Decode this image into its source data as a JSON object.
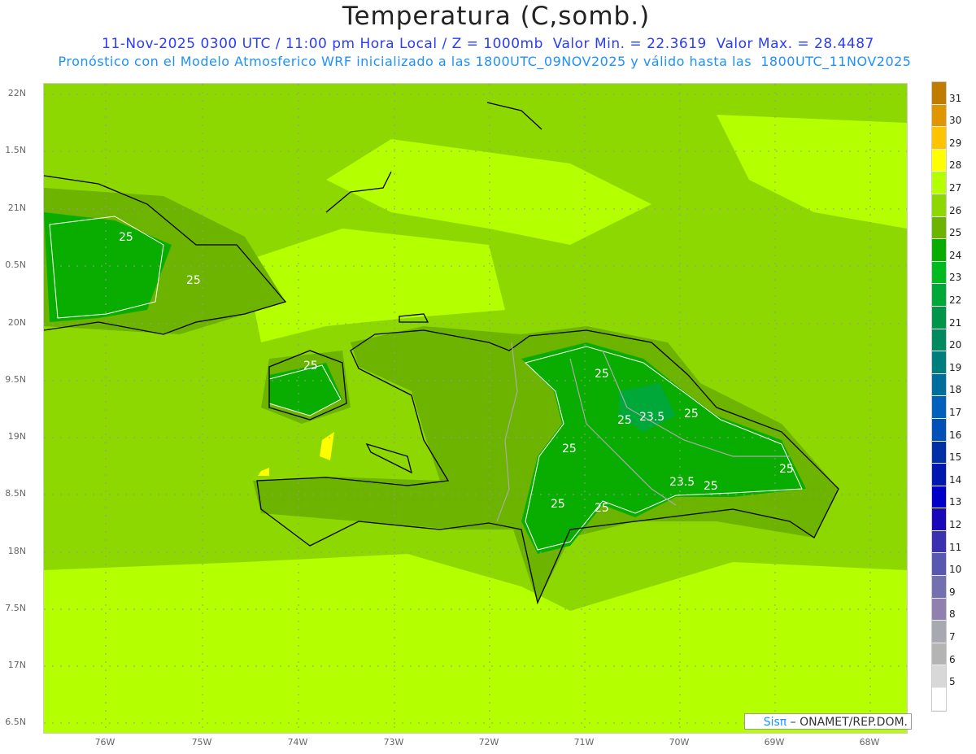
{
  "title": "Temperatura (C,somb.)",
  "subtitle_line1": "11-Nov-2025 0300 UTC / 11:00 pm Hora Local / Z = 1000mb  Valor Min. = 22.3619  Valor Max. = 28.4487",
  "subtitle_line2": "Pronóstico con el Modelo Atmosferico WRF inicializado a las 1800UTC_09NOV2025 y válido hasta las  1800UTC_11NOV2025",
  "lat_labels": [
    "22N",
    "1.5N",
    "21N",
    "0.5N",
    "20N",
    "9.5N",
    "19N",
    "8.5N",
    "18N",
    "7.5N",
    "17N",
    "6.5N"
  ],
  "lon_labels": [
    "76W",
    "75W",
    "74W",
    "73W",
    "72W",
    "71W",
    "70W",
    "69W",
    "68W"
  ],
  "contour_labels": [
    "25",
    "25",
    "25",
    "25",
    "25",
    "25",
    "23.5",
    "25",
    "25",
    "25",
    "23.5",
    "25",
    "25"
  ],
  "colorbar": {
    "labels": [
      "31",
      "30",
      "29",
      "28",
      "27",
      "26",
      "25",
      "24",
      "23",
      "22",
      "21",
      "20",
      "19",
      "18",
      "17",
      "16",
      "15",
      "14",
      "13",
      "12",
      "11",
      "10",
      "9",
      "8",
      "7",
      "6",
      "5"
    ],
    "colors": [
      "#c07c00",
      "#e09600",
      "#ffc400",
      "#ffff00",
      "#b4ff00",
      "#8cd800",
      "#6cb400",
      "#08ad00",
      "#00bb20",
      "#00a83a",
      "#009548",
      "#008a60",
      "#007e7e",
      "#006e9a",
      "#0060bb",
      "#0050b8",
      "#0030a8",
      "#0018b0",
      "#0000c8",
      "#1808b8",
      "#3a30b0",
      "#5858b0",
      "#7470b0",
      "#9080b0",
      "#a8a8b0",
      "#b4b4b4",
      "#d8d8d8",
      "#ffffff"
    ]
  },
  "credit": {
    "brand": "Sisπ",
    "text": "– ONAMET/REP.DOM."
  }
}
